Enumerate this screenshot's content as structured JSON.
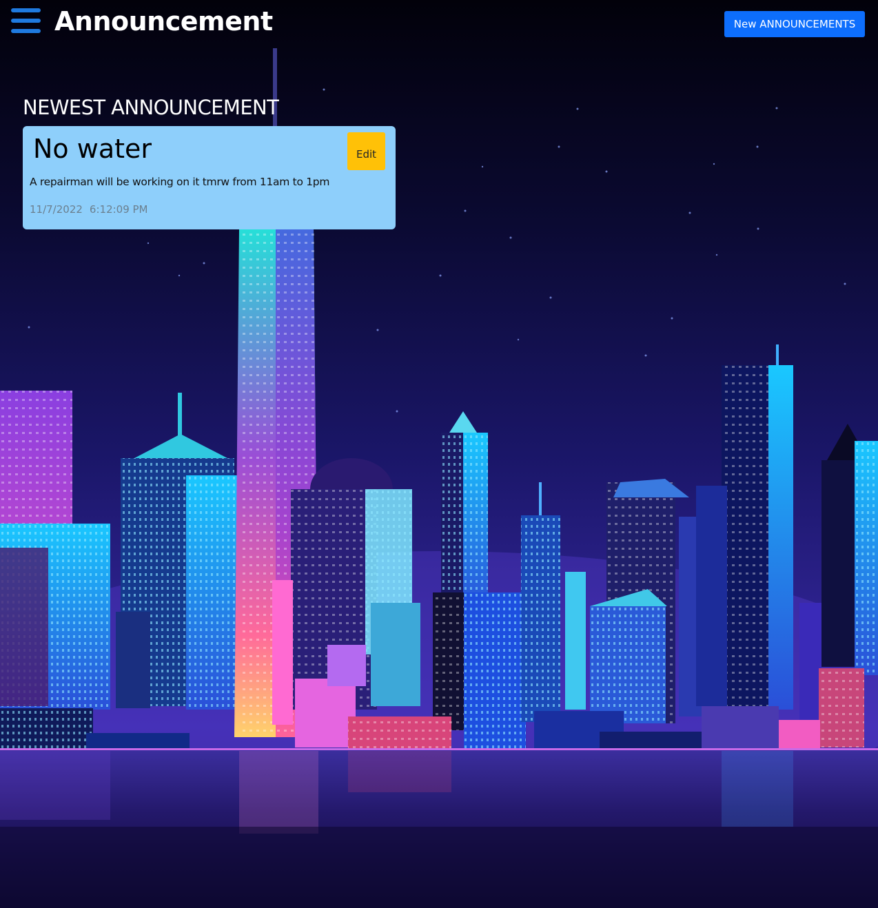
{
  "header": {
    "menu_icon": "hamburger-menu-icon",
    "title": "Announcement",
    "new_button_label": "New ANNOUNCEMENTS"
  },
  "main": {
    "section_heading": "NEWEST ANNOUNCEMENT",
    "announcement": {
      "title": "No water",
      "edit_label": "Edit",
      "body": "A repairman will be working on it tmrw from 11am to 1pm",
      "date": "11/7/2022",
      "time": "6:12:09 PM"
    }
  },
  "theme": {
    "primary_blue": "#0d6efd",
    "menu_icon_blue": "#1f7ae0",
    "card_bg": "#8ecffb",
    "edit_yellow": "#ffc107",
    "background": "night city skyline"
  }
}
